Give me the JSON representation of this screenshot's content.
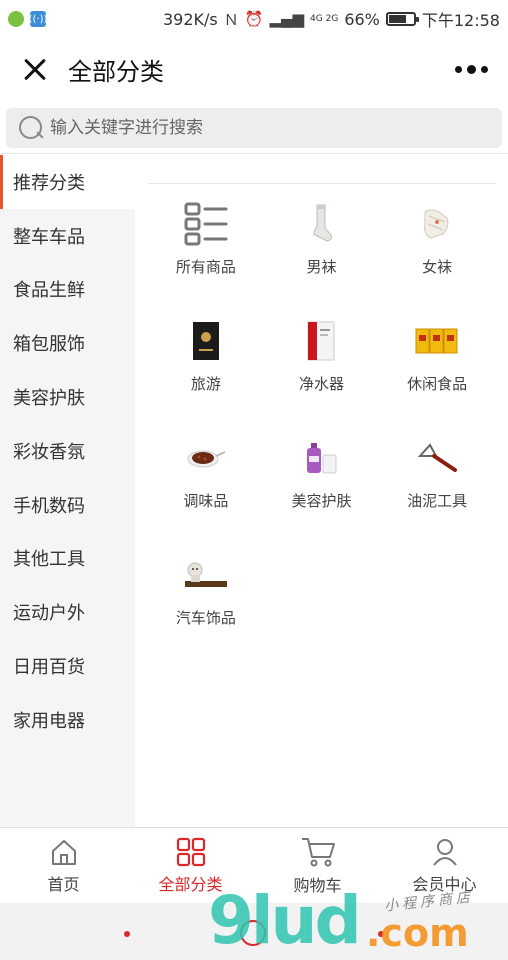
{
  "status_bar": {
    "speed": "392K/s",
    "signal_label": "4G 2G",
    "battery_text": "66%",
    "battery_level": 0.66,
    "time": "下午12:58"
  },
  "header": {
    "title": "全部分类"
  },
  "search": {
    "placeholder": "输入关键字进行搜索"
  },
  "sidebar": {
    "items": [
      {
        "label": "推荐分类"
      },
      {
        "label": "整车车品"
      },
      {
        "label": "食品生鲜"
      },
      {
        "label": "箱包服饰"
      },
      {
        "label": "美容护肤"
      },
      {
        "label": "彩妆香氛"
      },
      {
        "label": "手机数码"
      },
      {
        "label": "其他工具"
      },
      {
        "label": "运动户外"
      },
      {
        "label": "日用百货"
      },
      {
        "label": "家用电器"
      }
    ]
  },
  "categories": [
    {
      "label": "所有商品",
      "icon": "all-products-grid-icon"
    },
    {
      "label": "男袜",
      "icon": "mens-socks-image"
    },
    {
      "label": "女袜",
      "icon": "womens-socks-image"
    },
    {
      "label": "旅游",
      "icon": "travel-book-image"
    },
    {
      "label": "净水器",
      "icon": "water-purifier-image"
    },
    {
      "label": "休闲食品",
      "icon": "snack-packs-image"
    },
    {
      "label": "调味品",
      "icon": "seasoning-plate-image"
    },
    {
      "label": "美容护肤",
      "icon": "beauty-bottles-image"
    },
    {
      "label": "油泥工具",
      "icon": "putty-tool-image"
    },
    {
      "label": "汽车饰品",
      "icon": "car-ornament-image"
    }
  ],
  "tabbar": {
    "tabs": [
      {
        "label": "首页",
        "icon": "home-icon"
      },
      {
        "label": "全部分类",
        "icon": "category-grid-icon"
      },
      {
        "label": "购物车",
        "icon": "cart-icon"
      },
      {
        "label": "会员中心",
        "icon": "user-icon"
      }
    ],
    "active_color": "#d9292c"
  },
  "watermark": {
    "main": "9lud",
    "suffix": ".com",
    "tagline": "小程序商店"
  },
  "colors": {
    "accent": "#d9292c",
    "active_indicator": "#e4572e",
    "sidebar_bg": "#f5f5f5"
  }
}
